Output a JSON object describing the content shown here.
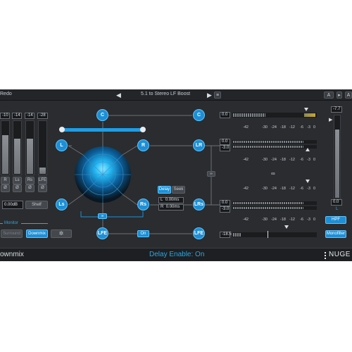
{
  "topbar": {
    "left_label": "Redo",
    "preset_name": "5.1 to Stereo LF Boost",
    "compare_label": "A",
    "compare2_label": "A"
  },
  "footer": {
    "title": "ownmix",
    "status": "Delay Enable: On",
    "logo": "NUGE"
  },
  "input_meters": {
    "values": [
      "-10",
      "-14",
      "-14",
      "-28"
    ],
    "labels": [
      "R",
      "Ls",
      "Rs",
      "LFE"
    ],
    "phase": [
      "Ø",
      "Ø",
      "Ø",
      "Ø"
    ],
    "levels": [
      0.72,
      0.66,
      0.66,
      0.12
    ]
  },
  "gain": {
    "value": "0.00dB",
    "shelf_label": "Shelf"
  },
  "monitor": {
    "title": "Monitor",
    "surround_label": "Surround",
    "downmix_label": "Downmix",
    "gear": "gear-icon"
  },
  "matrix": {
    "nodes": {
      "c_in": "C",
      "c_out": "C",
      "l": "L",
      "r": "R",
      "lr": "LR",
      "ls": "Ls",
      "rs": "Rs",
      "lrs": "LRs",
      "lfe_in": "LFE",
      "lfe_out": "LFE",
      "on": "On"
    },
    "link_icon": "link-icon"
  },
  "delay": {
    "delay_label": "Delay",
    "seek_label": "Seek",
    "l_label": "L",
    "l_value": "0.00ms",
    "r_label": "R",
    "r_value": "0.00ms"
  },
  "out_gains": [
    "0.0",
    "0.0",
    "-3.0",
    "0.0",
    "-3.0",
    "-18.5"
  ],
  "scale_ticks": [
    "-42",
    "-30",
    "-24",
    "-18",
    "-12",
    "-6",
    "-3",
    "0"
  ],
  "master": {
    "peak": "-7.7",
    "value": "0.0",
    "ch_label": "L",
    "hpf_label": "HPF",
    "monofilter_label": "Monofilter"
  }
}
